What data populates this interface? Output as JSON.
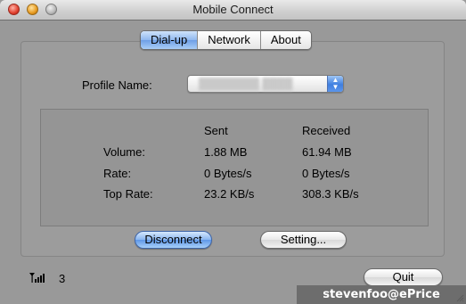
{
  "window": {
    "title": "Mobile Connect"
  },
  "tabs": [
    {
      "label": "Dial-up",
      "active": true
    },
    {
      "label": "Network",
      "active": false
    },
    {
      "label": "About",
      "active": false
    }
  ],
  "profile": {
    "label": "Profile Name:"
  },
  "stats": {
    "col_sent": "Sent",
    "col_received": "Received",
    "rows": [
      {
        "label": "Volume:",
        "sent": "1.88 MB",
        "received": "61.94 MB"
      },
      {
        "label": "Rate:",
        "sent": "0 Bytes/s",
        "received": "0 Bytes/s"
      },
      {
        "label": "Top Rate:",
        "sent": "23.2 KB/s",
        "received": "308.3 KB/s"
      }
    ]
  },
  "buttons": {
    "disconnect": "Disconnect",
    "setting": "Setting...",
    "quit": "Quit"
  },
  "status": {
    "signal_icon": "signal-bars-icon",
    "signal_level": "3"
  },
  "watermark": "stevenfoo@ePrice",
  "colors": {
    "accent_blue": "#6e9fe6",
    "window_bg": "#999999",
    "watermark_bg": "#6d6d6d"
  }
}
